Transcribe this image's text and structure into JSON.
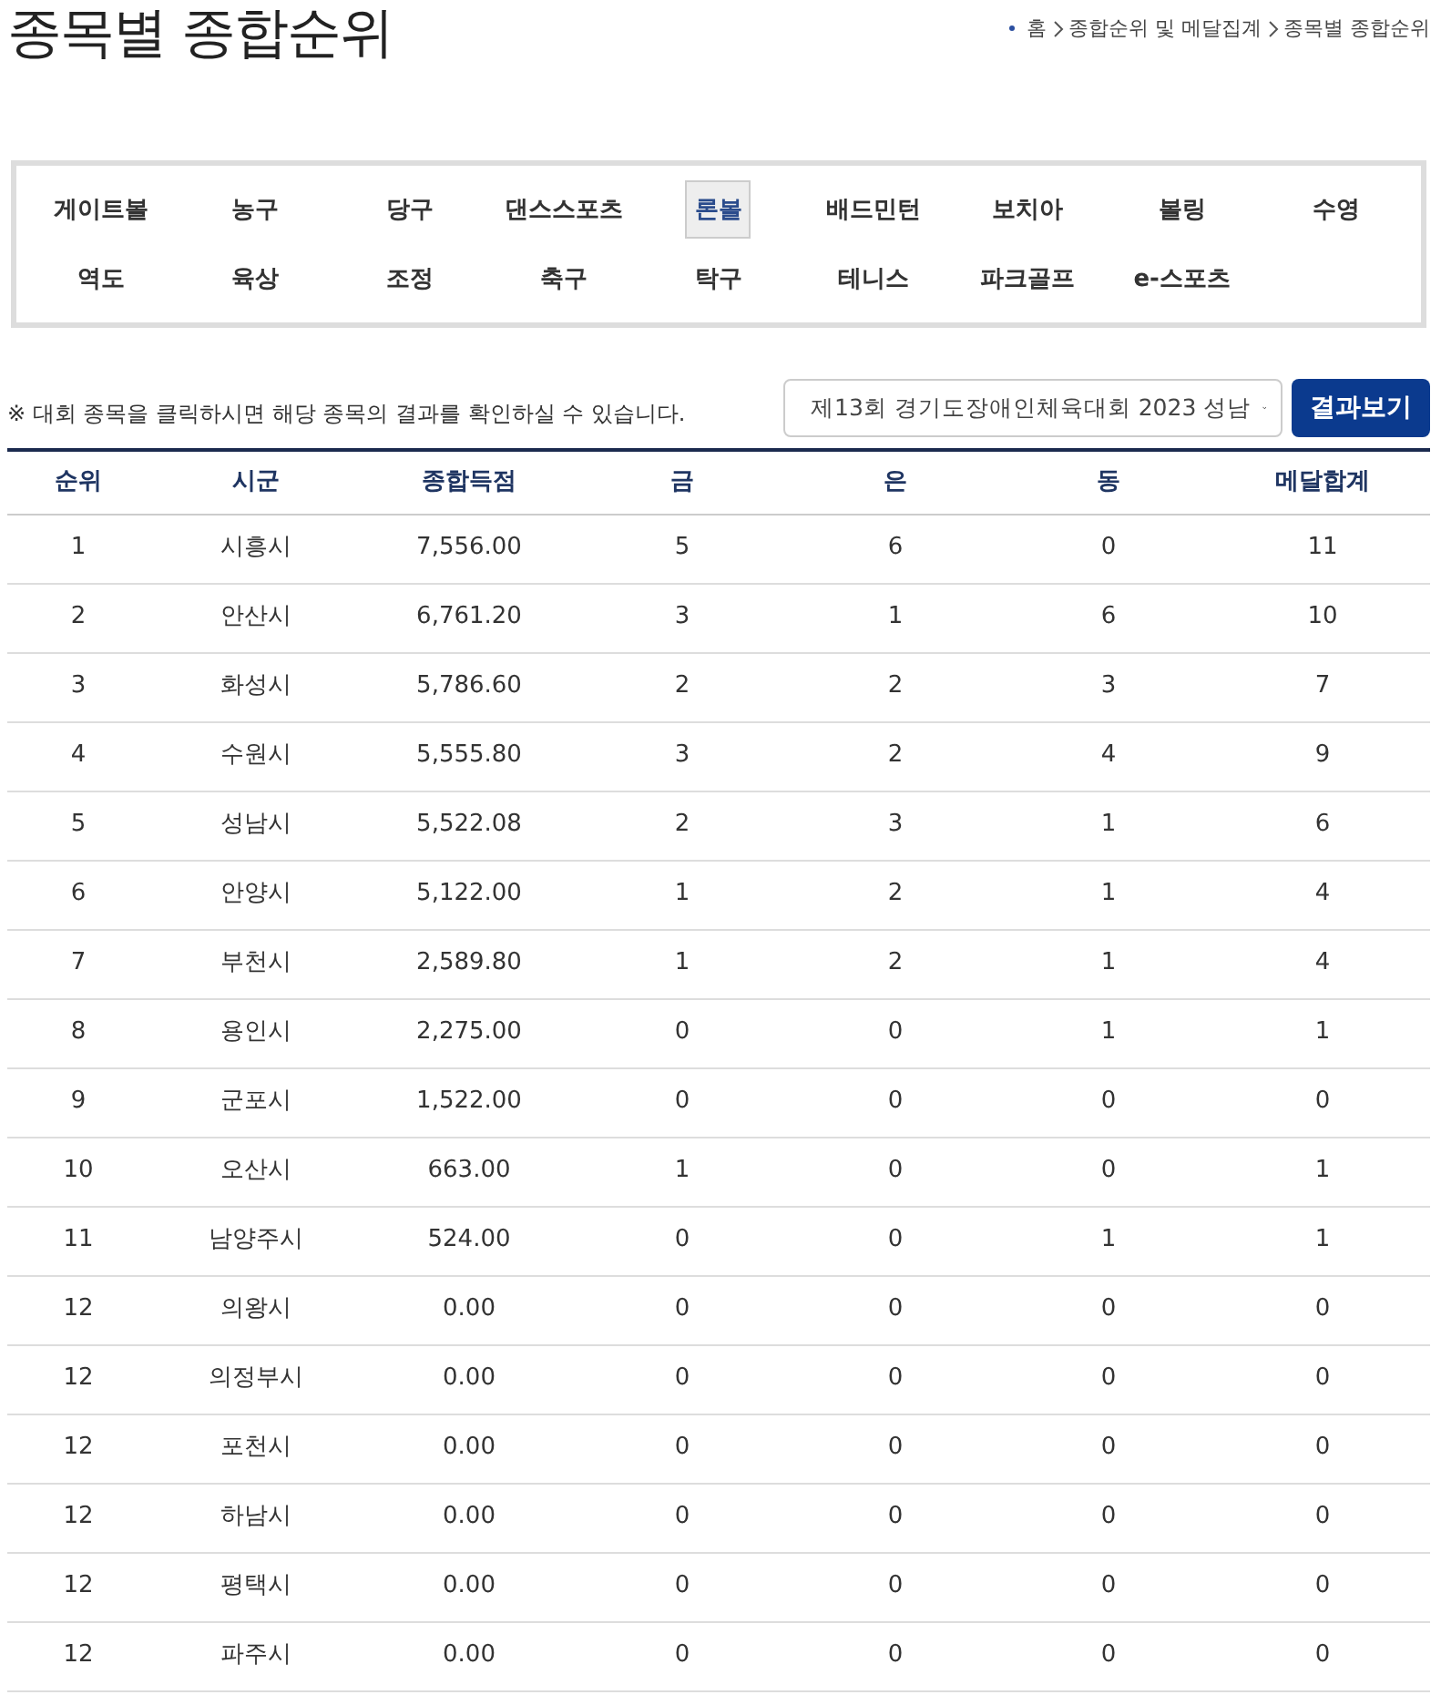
{
  "page_title": "종목별 종합순위",
  "breadcrumb": [
    "홈",
    "종합순위 및 메달집계",
    "종목별 종합순위"
  ],
  "sports": [
    {
      "label": "게이트볼",
      "selected": false
    },
    {
      "label": "농구",
      "selected": false
    },
    {
      "label": "당구",
      "selected": false
    },
    {
      "label": "댄스스포츠",
      "selected": false
    },
    {
      "label": "론볼",
      "selected": true
    },
    {
      "label": "배드민턴",
      "selected": false
    },
    {
      "label": "보치아",
      "selected": false
    },
    {
      "label": "볼링",
      "selected": false
    },
    {
      "label": "수영",
      "selected": false
    },
    {
      "label": "역도",
      "selected": false
    },
    {
      "label": "육상",
      "selected": false
    },
    {
      "label": "조정",
      "selected": false
    },
    {
      "label": "축구",
      "selected": false
    },
    {
      "label": "탁구",
      "selected": false
    },
    {
      "label": "테니스",
      "selected": false
    },
    {
      "label": "파크골프",
      "selected": false
    },
    {
      "label": "e-스포츠",
      "selected": false
    }
  ],
  "notice": "※ 대회 종목을 클릭하시면 해당 종목의 결과를 확인하실 수 있습니다.",
  "event_select": {
    "value": "제13회 경기도장애인체육대회 2023 성남"
  },
  "result_button": "결과보기",
  "table": {
    "columns": [
      "순위",
      "시군",
      "종합득점",
      "금",
      "은",
      "동",
      "메달합계"
    ],
    "rows": [
      [
        "1",
        "시흥시",
        "7,556.00",
        "5",
        "6",
        "0",
        "11"
      ],
      [
        "2",
        "안산시",
        "6,761.20",
        "3",
        "1",
        "6",
        "10"
      ],
      [
        "3",
        "화성시",
        "5,786.60",
        "2",
        "2",
        "3",
        "7"
      ],
      [
        "4",
        "수원시",
        "5,555.80",
        "3",
        "2",
        "4",
        "9"
      ],
      [
        "5",
        "성남시",
        "5,522.08",
        "2",
        "3",
        "1",
        "6"
      ],
      [
        "6",
        "안양시",
        "5,122.00",
        "1",
        "2",
        "1",
        "4"
      ],
      [
        "7",
        "부천시",
        "2,589.80",
        "1",
        "2",
        "1",
        "4"
      ],
      [
        "8",
        "용인시",
        "2,275.00",
        "0",
        "0",
        "1",
        "1"
      ],
      [
        "9",
        "군포시",
        "1,522.00",
        "0",
        "0",
        "0",
        "0"
      ],
      [
        "10",
        "오산시",
        "663.00",
        "1",
        "0",
        "0",
        "1"
      ],
      [
        "11",
        "남양주시",
        "524.00",
        "0",
        "0",
        "1",
        "1"
      ],
      [
        "12",
        "의왕시",
        "0.00",
        "0",
        "0",
        "0",
        "0"
      ],
      [
        "12",
        "의정부시",
        "0.00",
        "0",
        "0",
        "0",
        "0"
      ],
      [
        "12",
        "포천시",
        "0.00",
        "0",
        "0",
        "0",
        "0"
      ],
      [
        "12",
        "하남시",
        "0.00",
        "0",
        "0",
        "0",
        "0"
      ],
      [
        "12",
        "평택시",
        "0.00",
        "0",
        "0",
        "0",
        "0"
      ],
      [
        "12",
        "파주시",
        "0.00",
        "0",
        "0",
        "0",
        "0"
      ]
    ]
  }
}
